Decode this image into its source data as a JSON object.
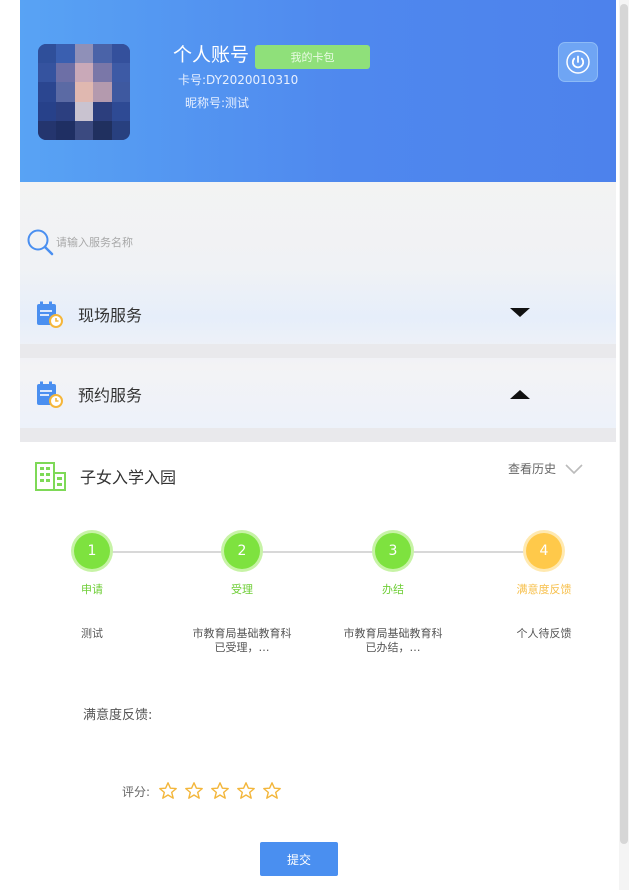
{
  "profile": {
    "account_title": "个人账号",
    "card_button": "我的卡包",
    "card_number": "卡号:DY2020010310",
    "nickname": "昵称号:测试"
  },
  "search": {
    "placeholder": "请输入服务名称"
  },
  "services": [
    {
      "label": "现场服务",
      "expanded": false
    },
    {
      "label": "预约服务",
      "expanded": true
    }
  ],
  "item": {
    "title": "子女入学入园",
    "history_label": "查看历史"
  },
  "progress": {
    "steps": [
      {
        "number": "1",
        "label": "申请",
        "desc": "测试",
        "status": "done"
      },
      {
        "number": "2",
        "label": "受理",
        "desc": "市教育局基础教育科已受理，…",
        "status": "done"
      },
      {
        "number": "3",
        "label": "办结",
        "desc": "市教育局基础教育科已办结，…",
        "status": "done"
      },
      {
        "number": "4",
        "label": "满意度反馈",
        "desc": "个人待反馈",
        "status": "current"
      }
    ]
  },
  "feedback": {
    "label": "满意度反馈:",
    "rating_label": "评分:",
    "stars_total": 5,
    "stars_selected": 0
  },
  "submit_label": "提交",
  "colors": {
    "header_blue": "#4f88ee",
    "step_green": "#7ee23f",
    "step_orange": "#ffc94a",
    "submit_blue": "#4a8ff0"
  }
}
